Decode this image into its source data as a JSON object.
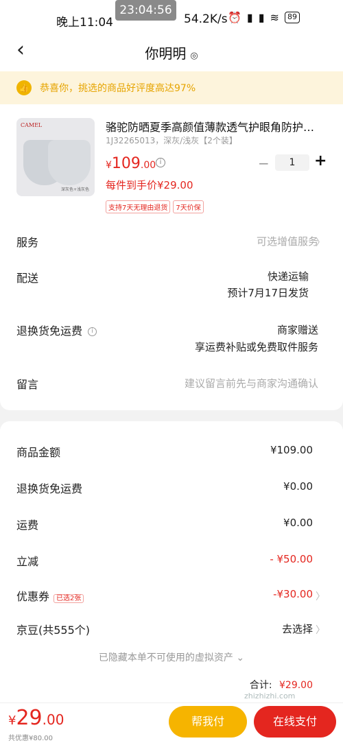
{
  "status_bar": {
    "time": "晚上11:04",
    "overlay_time": "23:04:56",
    "network_speed": "54.2K/s",
    "battery": "89"
  },
  "header": {
    "title": "你明明"
  },
  "banner": {
    "text": "恭喜你，挑选的商品好评度高达97%"
  },
  "product": {
    "title": "骆驼防晒夏季高颜值薄款透气护眼角防护…",
    "spec": "1J32265013，深灰/浅灰【2个装】",
    "price_symbol": "¥",
    "price_int": "109",
    "price_dec": ".00",
    "quantity": "1",
    "minus": "−",
    "plus": "+",
    "unit_price": "每件到手价¥29.00",
    "tags": [
      "支持7天无理由退货",
      "7天价保"
    ],
    "image_brand": "CAMEL",
    "image_caption": "深灰色+浅灰色"
  },
  "rows": {
    "service": {
      "label": "服务",
      "value": "可选增值服务"
    },
    "delivery": {
      "label": "配送",
      "value": "快递运输",
      "eta": "预计7月17日发货"
    },
    "return_fee": {
      "label": "退换货免运费",
      "value": "商家赠送",
      "sub": "享运费补贴或免费取件服务"
    },
    "note": {
      "label": "留言",
      "placeholder": "建议留言前先与商家沟通确认"
    }
  },
  "summary": {
    "goods_amount": {
      "label": "商品金额",
      "value": "¥109.00"
    },
    "return_fee": {
      "label": "退换货免运费",
      "value": "¥0.00"
    },
    "shipping": {
      "label": "运费",
      "value": "¥0.00"
    },
    "discount": {
      "label": "立减",
      "value": "- ¥50.00"
    },
    "coupon": {
      "label": "优惠券",
      "badge": "已选2张",
      "value": "-¥30.00"
    },
    "jingdou": {
      "label": "京豆(共555个)",
      "value": "去选择"
    },
    "hidden_note": "已隐藏本单不可使用的虚拟资产 ⌄",
    "total_label": "合计:",
    "total_value": "¥29.00"
  },
  "bottom": {
    "price_symbol": "¥",
    "price_int": "29",
    "price_dec": ".00",
    "saved": "共优惠¥80.00",
    "help_button": "帮我付",
    "pay_button": "在线支付"
  },
  "watermark": "zhizhizhi.com",
  "colors": {
    "accent_red": "#e4261f",
    "help_yellow": "#f6b400",
    "banner_bg": "#fdf4dc"
  }
}
